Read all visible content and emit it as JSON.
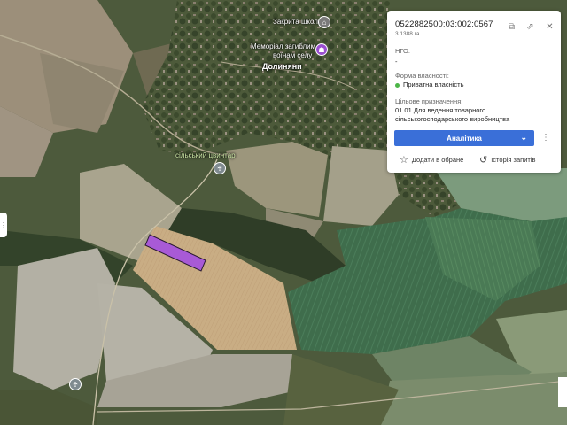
{
  "map": {
    "labels": {
      "school": "Закрита школа",
      "memorial_line1": "Меморіал загиблим",
      "memorial_line2": "воїнам селу",
      "town": "Долиняни",
      "cemetery": "сільський цвинтар"
    },
    "parcel_color": "#a85ad6",
    "icons": [
      "school-icon",
      "memorial-icon",
      "cemetery-icon",
      "cemetery-icon-2"
    ]
  },
  "panel": {
    "cadastral_number": "0522882500:03:002:0567",
    "area": "3.1388 га",
    "ngo_label": "НГО:",
    "ngo_value": "-",
    "ownership_label": "Форма власності:",
    "ownership_value": "Приватна власність",
    "ownership_color": "#4cb648",
    "purpose_label": "Цільове призначення:",
    "purpose_line1": "01.01 Для ведення товарного",
    "purpose_line2": "сільськогосподарського виробництва",
    "analytics_button": "Аналітика",
    "add_favorites": "Додати в обране",
    "request_history": "Історія запитів",
    "accent_color": "#3a6fd8"
  }
}
